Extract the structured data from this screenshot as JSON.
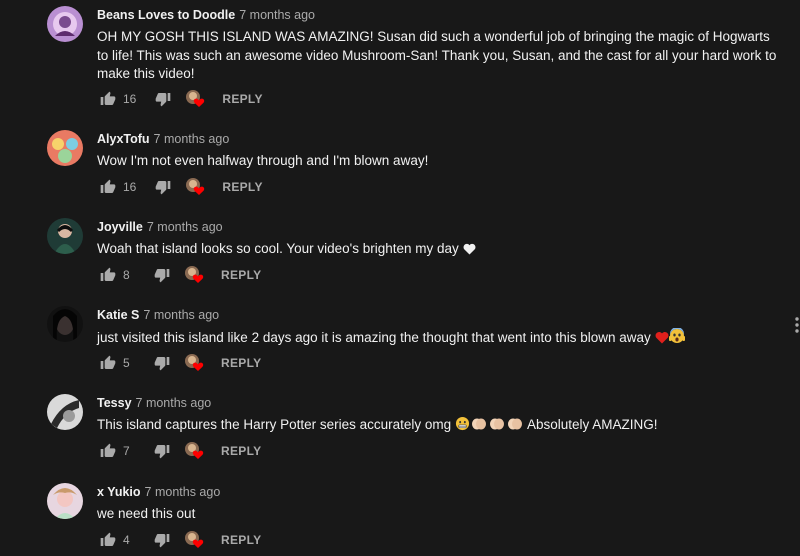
{
  "comments": [
    {
      "author": "Beans Loves to Doodle",
      "time": "7 months ago",
      "text": "OH MY GOSH THIS ISLAND WAS AMAZING! Susan did such a wonderful job of bringing the magic of Hogwarts to life! This was such an awesome video Mushroom-San! Thank you, Susan, and the cast for all your hard work to make this video!",
      "likes": "16",
      "reply_label": "REPLY"
    },
    {
      "author": "AlyxTofu",
      "time": "7 months ago",
      "text": "Wow I'm not even halfway through and I'm blown away!",
      "likes": "16",
      "reply_label": "REPLY"
    },
    {
      "author": "Joyville",
      "time": "7 months ago",
      "text": "Woah that island looks so cool. Your video's brighten my day",
      "text_emoji": "white-heart",
      "likes": "8",
      "reply_label": "REPLY"
    },
    {
      "author": "Katie S",
      "time": "7 months ago",
      "text": "just visited this island like 2 days ago it is amazing the thought that went into this blown away",
      "text_emoji": "red-heart, screaming-face",
      "likes": "5",
      "reply_label": "REPLY"
    },
    {
      "author": "Tessy",
      "time": "7 months ago",
      "text_before": "This island captures the Harry Potter series accurately omg",
      "text_after": "Absolutely AMAZING!",
      "text_emoji": "grimacing-face, clapping-hands x3",
      "likes": "7",
      "reply_label": "REPLY"
    },
    {
      "author": "x Yukio",
      "time": "7 months ago",
      "text": "we need this out",
      "likes": "4",
      "reply_label": "REPLY"
    }
  ],
  "icons": {
    "like": "thumbs-up-icon",
    "dislike": "thumbs-down-icon",
    "creator_heart": "creator-heart-icon",
    "menu": "more-vertical-icon"
  },
  "colors": {
    "background": "#181818",
    "text": "#f1f1f1",
    "secondary": "#aaaaaa",
    "heart": "#ff0000"
  }
}
